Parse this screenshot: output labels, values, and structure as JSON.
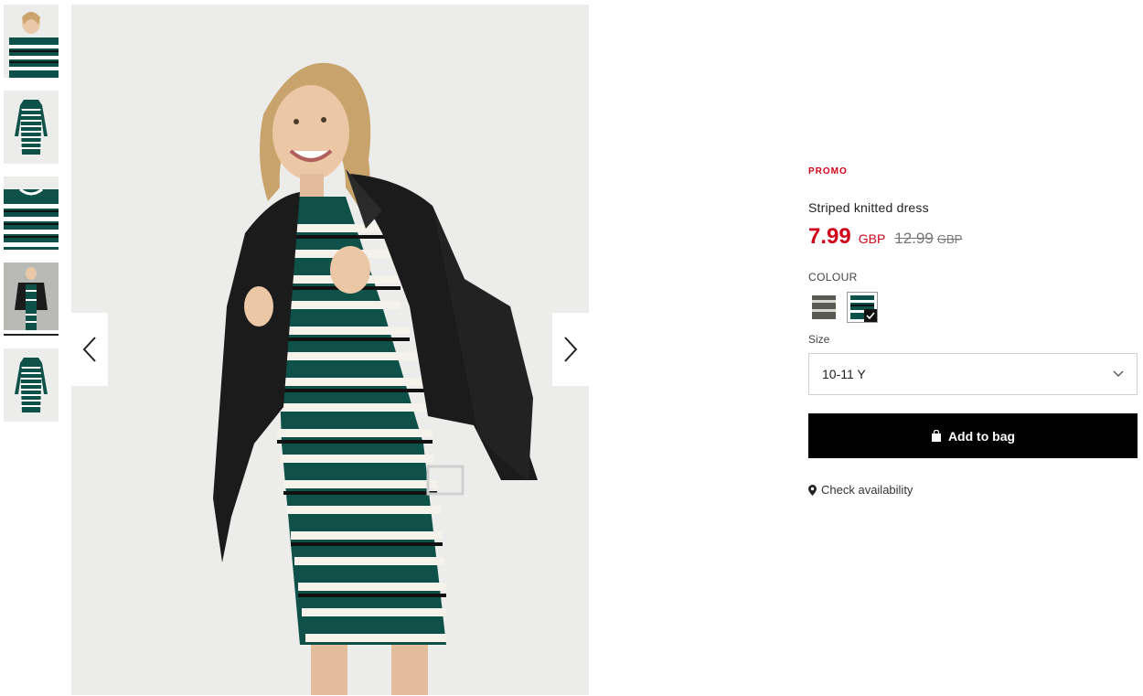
{
  "gallery": {
    "thumbnails": [
      {
        "name": "thumb-model-closeup"
      },
      {
        "name": "thumb-dress-flat"
      },
      {
        "name": "thumb-fabric-detail"
      },
      {
        "name": "thumb-model-jacket"
      },
      {
        "name": "thumb-dress-flat-back"
      }
    ],
    "active_index": 4,
    "prev_icon": "chevron-left-icon",
    "next_icon": "chevron-right-icon"
  },
  "product": {
    "promo_label": "PROMO",
    "title": "Striped knitted dress",
    "price_current": "7.99",
    "currency_current": "GBP",
    "price_original": "12.99",
    "currency_original": "GBP",
    "colour_label": "COLOUR",
    "colours": [
      {
        "name": "grey-stripe",
        "color": "#5a5a55",
        "stripe": "#d9d9d2",
        "selected": false
      },
      {
        "name": "green-stripe",
        "color": "#0d5149",
        "stripe": "#ffffff",
        "selected": true
      }
    ],
    "size_label": "Size",
    "size_selected": "10-11 Y",
    "add_to_bag_label": "Add to bag",
    "check_availability_label": "Check availability"
  },
  "colors": {
    "accent_red": "#d0021b",
    "button_black": "#000000",
    "dress_green": "#0d5149",
    "jacket_black": "#1b1b1b"
  }
}
